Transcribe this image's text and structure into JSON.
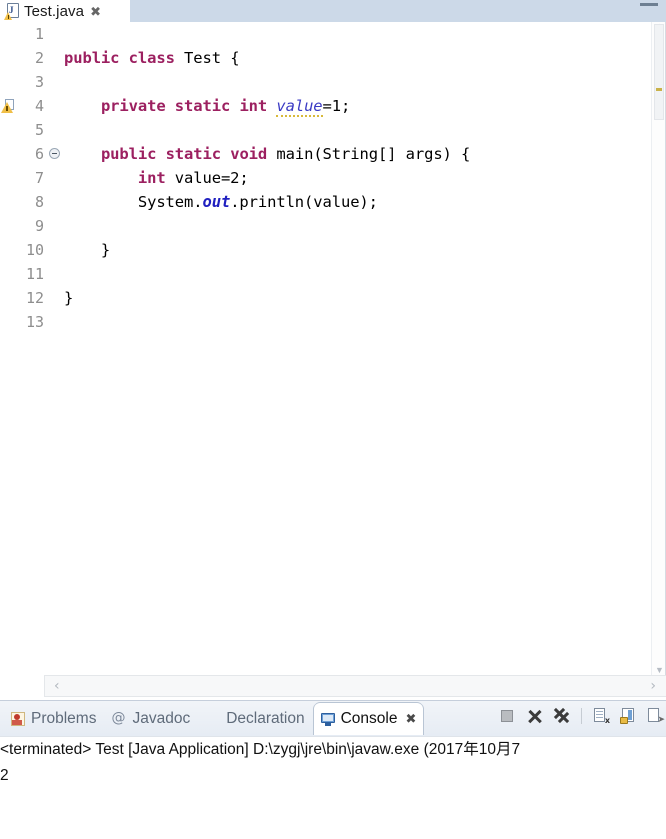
{
  "editor": {
    "tab": {
      "label": "Test.java",
      "close_glyph": "✖",
      "icon": "java-file-warning-icon"
    },
    "window_control": "minimize-restore-icon",
    "lines": [
      {
        "num": "1",
        "indent": 0,
        "tokens": []
      },
      {
        "num": "2",
        "indent": 0,
        "tokens": [
          {
            "t": "public",
            "c": "kw"
          },
          {
            "t": " ",
            "c": "plain"
          },
          {
            "t": "class",
            "c": "kw"
          },
          {
            "t": " Test {",
            "c": "plain"
          }
        ]
      },
      {
        "num": "3",
        "indent": 0,
        "tokens": []
      },
      {
        "num": "4",
        "indent": 0,
        "highlight": true,
        "marker": "warning",
        "tokens": [
          {
            "t": "    ",
            "c": "plain"
          },
          {
            "t": "private",
            "c": "kw"
          },
          {
            "t": " ",
            "c": "plain"
          },
          {
            "t": "static",
            "c": "kw"
          },
          {
            "t": " ",
            "c": "plain"
          },
          {
            "t": "int",
            "c": "kw"
          },
          {
            "t": " ",
            "c": "plain"
          },
          {
            "t": "value",
            "c": "fld-warn"
          },
          {
            "t": "=1;",
            "c": "plain"
          }
        ]
      },
      {
        "num": "5",
        "indent": 0,
        "tokens": []
      },
      {
        "num": "6",
        "indent": 0,
        "fold": true,
        "tokens": [
          {
            "t": "    ",
            "c": "plain"
          },
          {
            "t": "public",
            "c": "kw"
          },
          {
            "t": " ",
            "c": "plain"
          },
          {
            "t": "static",
            "c": "kw"
          },
          {
            "t": " ",
            "c": "plain"
          },
          {
            "t": "void",
            "c": "kw"
          },
          {
            "t": " main(String[] args) {",
            "c": "plain"
          }
        ]
      },
      {
        "num": "7",
        "indent": 0,
        "tokens": [
          {
            "t": "        ",
            "c": "plain"
          },
          {
            "t": "int",
            "c": "kw"
          },
          {
            "t": " value=2;",
            "c": "plain"
          }
        ]
      },
      {
        "num": "8",
        "indent": 0,
        "tokens": [
          {
            "t": "        System.",
            "c": "plain"
          },
          {
            "t": "out",
            "c": "statfld"
          },
          {
            "t": ".println(value);",
            "c": "plain"
          }
        ]
      },
      {
        "num": "9",
        "indent": 0,
        "tokens": []
      },
      {
        "num": "10",
        "indent": 0,
        "tokens": [
          {
            "t": "    }",
            "c": "plain"
          }
        ]
      },
      {
        "num": "11",
        "indent": 0,
        "tokens": []
      },
      {
        "num": "12",
        "indent": 0,
        "tokens": [
          {
            "t": "}",
            "c": "plain"
          }
        ]
      },
      {
        "num": "13",
        "indent": 0,
        "tokens": []
      }
    ],
    "h_scroll": {
      "left_arrow": "‹",
      "right_arrow": "›"
    }
  },
  "bottom_panel": {
    "tabs": [
      {
        "label": "Problems",
        "icon": "problems-icon",
        "active": false,
        "closeable": false
      },
      {
        "label": "Javadoc",
        "icon": "javadoc-icon",
        "active": false,
        "closeable": false
      },
      {
        "label": "Declaration",
        "icon": "declaration-icon",
        "active": false,
        "closeable": false
      },
      {
        "label": "Console",
        "icon": "console-icon",
        "active": true,
        "closeable": true
      }
    ],
    "tab_close_glyph": "✖",
    "toolbar": [
      {
        "name": "terminate-button",
        "kind": "terminate"
      },
      {
        "name": "remove-launch-button",
        "kind": "x"
      },
      {
        "name": "remove-all-terminated-button",
        "kind": "xx"
      },
      {
        "name": "separator",
        "kind": "sep"
      },
      {
        "name": "clear-console-button",
        "kind": "doc"
      },
      {
        "name": "scroll-lock-button",
        "kind": "lock"
      },
      {
        "name": "pin-console-button",
        "kind": "pin"
      }
    ],
    "console": {
      "header": "<terminated> Test [Java Application] D:\\zygj\\jre\\bin\\javaw.exe (2017年10月7",
      "output": "2"
    }
  },
  "colors": {
    "tabbar_bg": "#ccd9e8",
    "keyword": "#9c2060",
    "field_italic": "#3b3bc4",
    "static_field": "#2020c0",
    "line_number": "#8e8e8e",
    "highlight_line": "#e9f1fb",
    "warning_underline": "#d8b93a"
  }
}
